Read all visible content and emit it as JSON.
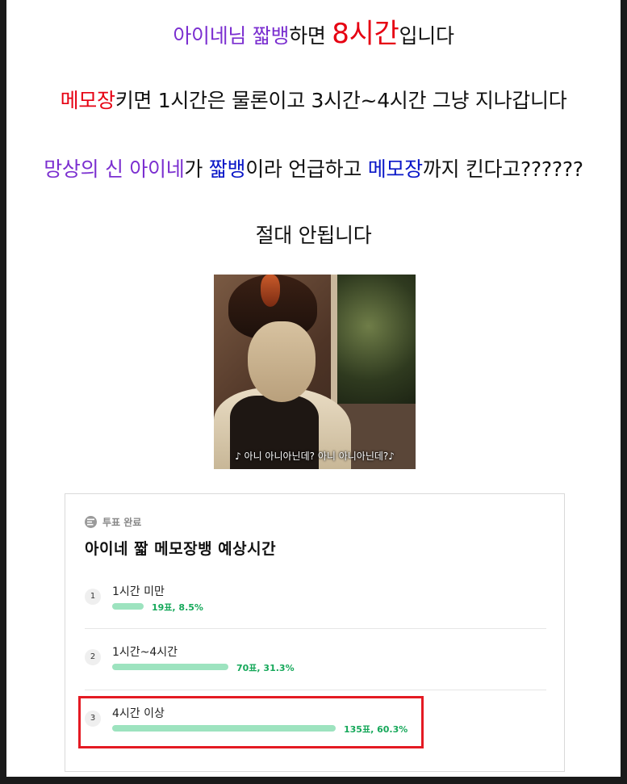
{
  "article": {
    "line1": {
      "a": "아이네님 짧뱅",
      "b": "하면 ",
      "c": "8시간",
      "d": "입니다"
    },
    "line2": {
      "a": "메모장",
      "b": "키면 1시간은 물론이고 3시간~4시간 그냥 지나갑니다"
    },
    "line3": {
      "a": "망상의 신 아이네",
      "b": "가 ",
      "c": "짧뱅",
      "d": "이라 언급하고 ",
      "e": "메모장",
      "f": "까지 킨다고??????"
    },
    "line4": "절대 안됩니다"
  },
  "image": {
    "caption": "♪ 아니 아니아닌데? 아니 아니아닌데?♪"
  },
  "poll": {
    "status": "투표 완료",
    "status_icon": "poll-icon",
    "title": "아이네 짧 메모장뱅 예상시간",
    "options": [
      {
        "number": "1",
        "label": "1시간 미만",
        "votes_text": "19표, 8.5%",
        "percent": 8.5
      },
      {
        "number": "2",
        "label": "1시간~4시간",
        "votes_text": "70표, 31.3%",
        "percent": 31.3
      },
      {
        "number": "3",
        "label": "4시간 이상",
        "votes_text": "135표, 60.3%",
        "percent": 60.3
      }
    ]
  },
  "colors": {
    "purple": "#7b2fd0",
    "red": "#e60012",
    "blue": "#0a17c8",
    "bar": "#9de3bf",
    "vote_text": "#16a85a",
    "highlight": "#e41a23"
  }
}
